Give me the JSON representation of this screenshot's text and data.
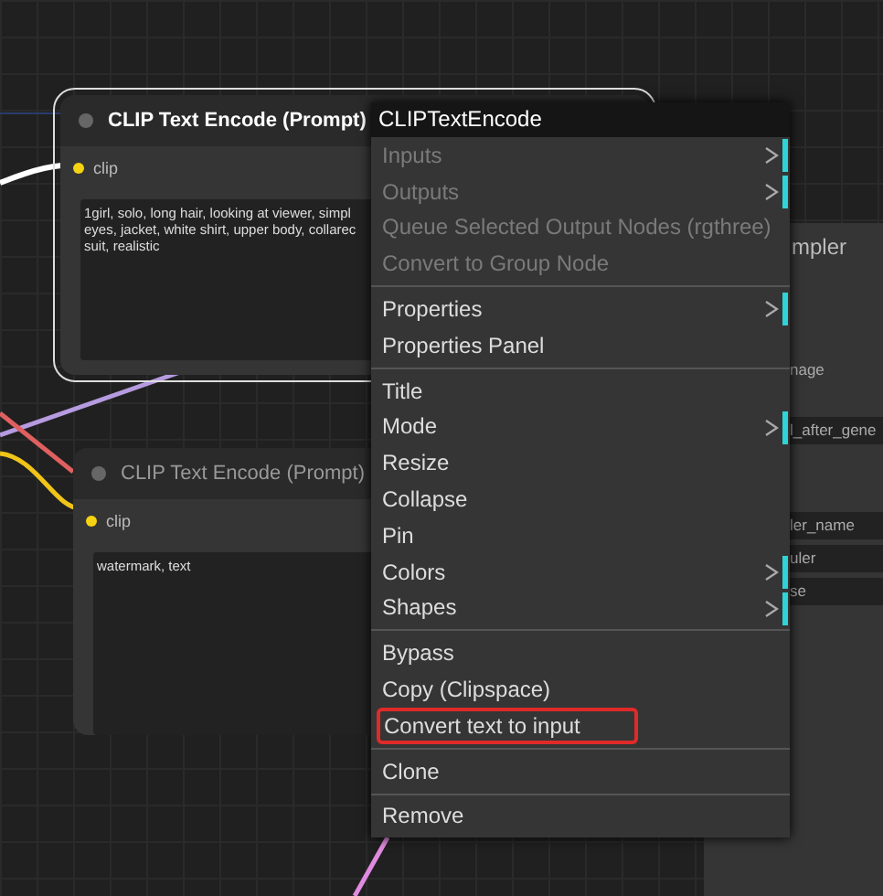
{
  "nodes": [
    {
      "title": "CLIP Text Encode (Prompt)",
      "selected": true,
      "input": "clip",
      "text_lines": [
        "1girl, solo, long hair, looking at viewer, simpl",
        "eyes, jacket, white shirt, upper body, collarec",
        "suit, realistic"
      ]
    },
    {
      "title": "CLIP Text Encode (Prompt)",
      "selected": false,
      "input": "clip",
      "text_lines": [
        "watermark, text"
      ]
    }
  ],
  "side_node": {
    "title": "mpler",
    "widgets": [
      "nage",
      "l_after_gene",
      "ler_name",
      "uler",
      "se"
    ]
  },
  "context_menu": {
    "title": "CLIPTextEncode",
    "sections": [
      [
        {
          "label": "Inputs",
          "disabled": true,
          "submenu": true,
          "highlighted": false
        },
        {
          "label": "Outputs",
          "disabled": true,
          "submenu": true,
          "highlighted": false
        },
        {
          "label": "Queue Selected Output Nodes (rgthree)",
          "disabled": true,
          "submenu": false,
          "highlighted": false
        },
        {
          "label": "Convert to Group Node",
          "disabled": true,
          "submenu": false,
          "highlighted": false
        }
      ],
      [
        {
          "label": "Properties",
          "disabled": false,
          "submenu": true,
          "highlighted": false
        },
        {
          "label": "Properties Panel",
          "disabled": false,
          "submenu": false,
          "highlighted": false
        }
      ],
      [
        {
          "label": "Title",
          "disabled": false,
          "submenu": false,
          "highlighted": false
        },
        {
          "label": "Mode",
          "disabled": false,
          "submenu": true,
          "highlighted": false
        },
        {
          "label": "Resize",
          "disabled": false,
          "submenu": false,
          "highlighted": false
        },
        {
          "label": "Collapse",
          "disabled": false,
          "submenu": false,
          "highlighted": false
        },
        {
          "label": "Pin",
          "disabled": false,
          "submenu": false,
          "highlighted": false
        },
        {
          "label": "Colors",
          "disabled": false,
          "submenu": true,
          "highlighted": false
        },
        {
          "label": "Shapes",
          "disabled": false,
          "submenu": true,
          "highlighted": false
        }
      ],
      [
        {
          "label": "Bypass",
          "disabled": false,
          "submenu": false,
          "highlighted": false
        },
        {
          "label": "Copy (Clipspace)",
          "disabled": false,
          "submenu": false,
          "highlighted": false
        },
        {
          "label": "Convert text to input",
          "disabled": false,
          "submenu": false,
          "highlighted": true
        }
      ],
      [
        {
          "label": "Clone",
          "disabled": false,
          "submenu": false,
          "highlighted": false
        }
      ],
      [
        {
          "label": "Remove",
          "disabled": false,
          "submenu": false,
          "highlighted": false
        }
      ]
    ]
  }
}
